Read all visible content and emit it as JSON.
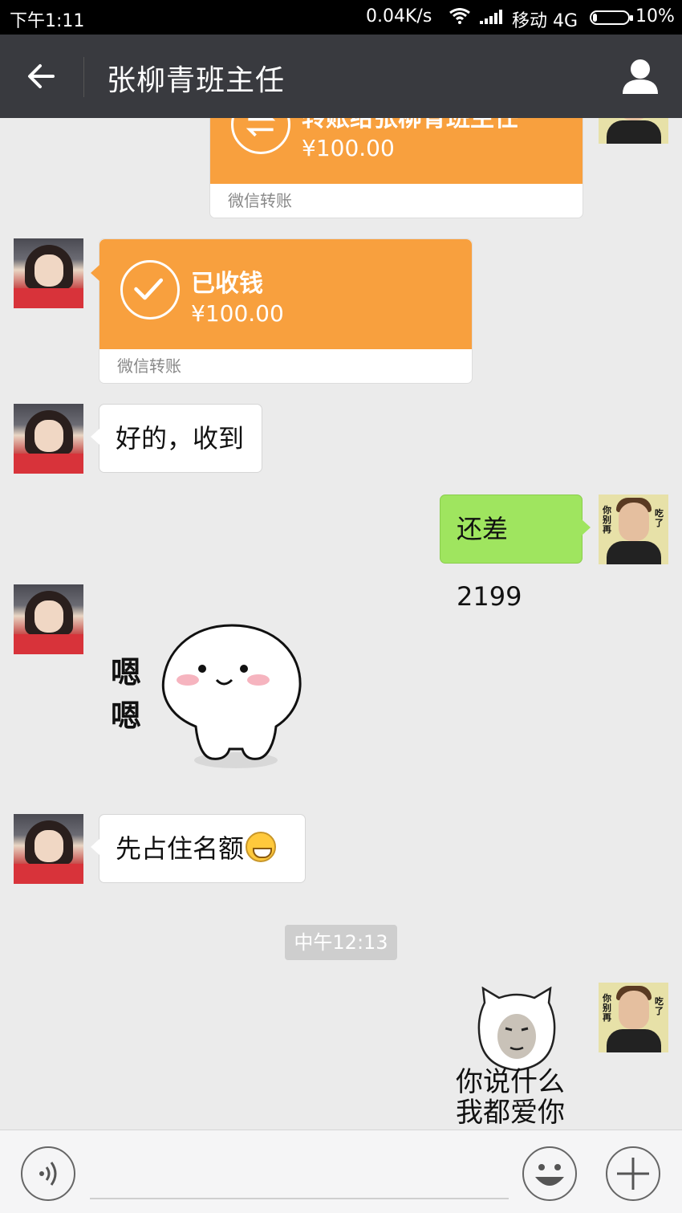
{
  "status_bar": {
    "time": "下午1:11",
    "net_speed": "0.04K/s",
    "carrier": "移动 4G",
    "battery": "10%"
  },
  "header": {
    "title": "张柳青班主任"
  },
  "messages": {
    "transfer_sent": {
      "label": "转账给张柳青班主任",
      "amount": "¥100.00",
      "footer": "微信转账"
    },
    "transfer_received": {
      "label": "已收钱",
      "amount": "¥100.00",
      "footer": "微信转账"
    },
    "msg1": "好的，收到",
    "msg2": "还差2199",
    "sticker1_text": "嗯嗯",
    "msg3": "先占住名额",
    "timestamp": "中午12:13",
    "sticker2_line1": "你说什么",
    "sticker2_line2": "我都爱你"
  },
  "avatar_me": {
    "left_text": "你别再",
    "right_text": "吃了"
  },
  "colors": {
    "transfer_orange": "#f8a03e",
    "sent_green": "#9fe55f",
    "header_bg": "#393a3f"
  }
}
